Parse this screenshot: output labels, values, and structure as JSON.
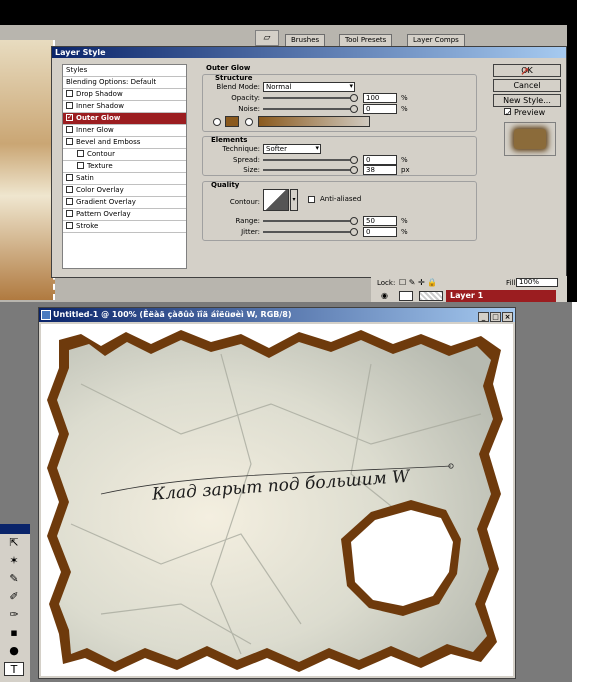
{
  "layer_style": {
    "palette_tabs": [
      "Brushes",
      "Tool Presets",
      "Layer Comps"
    ],
    "title": "Layer Style",
    "styles_list": [
      {
        "label": "Styles",
        "type": "header"
      },
      {
        "label": "Blending Options: Default",
        "type": "header"
      },
      {
        "label": "Drop Shadow",
        "checked": false
      },
      {
        "label": "Inner Shadow",
        "checked": false
      },
      {
        "label": "Outer Glow",
        "checked": true,
        "selected": true
      },
      {
        "label": "Inner Glow",
        "checked": false
      },
      {
        "label": "Bevel and Emboss",
        "checked": false
      },
      {
        "label": "Contour",
        "checked": false,
        "sub": true
      },
      {
        "label": "Texture",
        "checked": false,
        "sub": true
      },
      {
        "label": "Satin",
        "checked": false
      },
      {
        "label": "Color Overlay",
        "checked": false
      },
      {
        "label": "Gradient Overlay",
        "checked": false
      },
      {
        "label": "Pattern Overlay",
        "checked": false
      },
      {
        "label": "Stroke",
        "checked": false
      }
    ],
    "outer_glow": {
      "title": "Outer Glow",
      "structure": "Structure",
      "blend_mode_label": "Blend Mode:",
      "blend_mode": "Normal",
      "opacity_label": "Opacity:",
      "opacity": "100",
      "noise_label": "Noise:",
      "noise": "0",
      "elements": "Elements",
      "technique_label": "Technique:",
      "technique": "Softer",
      "spread_label": "Spread:",
      "spread": "0",
      "size_label": "Size:",
      "size": "38",
      "quality": "Quality",
      "contour_label": "Contour:",
      "anti_aliased": "Anti-aliased",
      "range_label": "Range:",
      "range": "50",
      "jitter_label": "Jitter:",
      "jitter": "0",
      "percent": "%",
      "px": "px",
      "glow_color": "#8b5a1e"
    },
    "buttons": {
      "ok": "OK",
      "cancel": "Cancel",
      "new_style": "New Style...",
      "preview": "Preview"
    },
    "layers": {
      "lock_label": "Lock:",
      "fill_label": "Fill:",
      "fill_value": "100%",
      "layer_name": "Layer 1"
    }
  },
  "document": {
    "title": "Untitled-1 @ 100% (Êëàä çàðûò ïîä áîëüøèì W, RGB/8)",
    "win_buttons": [
      "_",
      "□",
      "×"
    ],
    "inscription": "Клад зарыт под большим W",
    "colors": {
      "paper": "#ede6d4",
      "burn": "#8a4f16",
      "accent_selected": "#9b1d20"
    }
  }
}
